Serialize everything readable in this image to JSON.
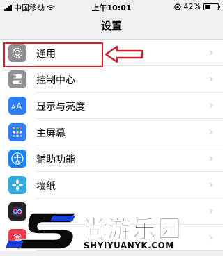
{
  "status_bar": {
    "carrier": "中国移动",
    "time": "上午10:01",
    "battery_percent": "42%",
    "battery_level": 0.42
  },
  "nav": {
    "title": "设置"
  },
  "settings": {
    "items": [
      {
        "label": "通用",
        "icon": "gear-icon",
        "color": "#8e8e93"
      },
      {
        "label": "控制中心",
        "icon": "toggle-icon",
        "color": "#8e8e93"
      },
      {
        "label": "显示与亮度",
        "icon": "text-size-icon",
        "color": "#2f7df6"
      },
      {
        "label": "主屏幕",
        "icon": "grid-icon",
        "color": "#2f7df6"
      },
      {
        "label": "辅助功能",
        "icon": "accessibility-icon",
        "color": "#1a82f2"
      },
      {
        "label": "墙纸",
        "icon": "wallpaper-icon",
        "color": "#33aadd"
      },
      {
        "label": "",
        "icon": "siri-icon",
        "color": "#222222"
      },
      {
        "label": "",
        "icon": "touch-id-icon",
        "color": "#ea3a4c"
      }
    ]
  },
  "annotation": {
    "color": "#d0202f"
  },
  "watermark": {
    "text": "尚游乐园",
    "url": "SHYIYUANYK.COM"
  }
}
